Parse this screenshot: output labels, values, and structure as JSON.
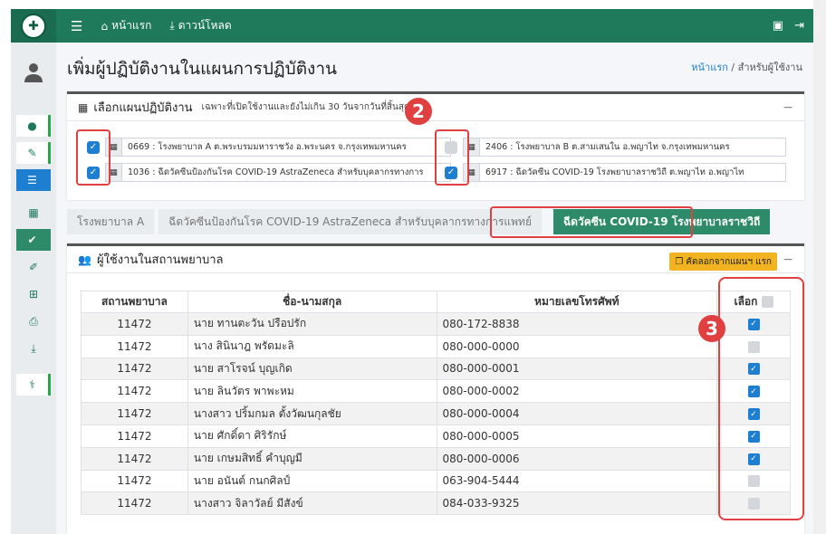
{
  "nav": {
    "home": "หน้าแรก",
    "download": "ดาวน์โหลด"
  },
  "page": {
    "title": "เพิ่มผู้ปฏิบัติงานในแผนการปฏิบัติงาน",
    "breadcrumb_home": "หน้าแรก",
    "breadcrumb_sep": "/",
    "breadcrumb_current": "สำหรับผู้ใช้งาน"
  },
  "plans_card": {
    "title": "เลือกแผนปฏิบัติงาน",
    "subtitle": "เฉพาะที่เปิดใช้งานและยังไม่เกิน 30 วันจากวันที่สิ้นสุด",
    "collapse": "−",
    "plans": [
      {
        "text": "0669 : โรงพยาบาล A  ต.พระบรมมหาราชวัง อ.พระนคร จ.กรุงเทพมหานคร",
        "checked": true
      },
      {
        "text": "2406 : โรงพยาบาล B  ต.สามเสนใน อ.พญาไท จ.กรุงเทพมหานคร",
        "checked": false
      },
      {
        "text": "1036 : ฉีดวัคซีนป้องกันโรค COVID-19 AstraZeneca สำหรับบุคลากรทางการ",
        "checked": true
      },
      {
        "text": "6917 : ฉีดวัคซีน COVID-19 โรงพยาบาลราชวิถี  ต.พญาไท อ.พญาไท",
        "checked": true
      }
    ]
  },
  "badges": {
    "b2": "2",
    "b3": "3"
  },
  "tabs": [
    {
      "label": "โรงพยาบาล A"
    },
    {
      "label": "ฉีดวัคซีนป้องกันโรค COVID-19 AstraZeneca สำหรับบุคลากรทางการแพทย์"
    },
    {
      "label": "ฉีดวัคซีน COVID-19 โรงพยาบาลราชวิถี"
    }
  ],
  "users_card": {
    "title": "ผู้ใช้งานในสถานพยาบาล",
    "copy_button": "คัดลอกจากแผนฯ แรก",
    "collapse": "−",
    "columns": {
      "hospital": "สถานพยาบาล",
      "name": "ชื่อ-นามสกุล",
      "phone": "หมายเลขโทรศัพท์",
      "select": "เลือก"
    },
    "rows": [
      {
        "hospital": "11472",
        "name": "นาย ทานตะวัน ปรือปรัก",
        "phone": "080-172-8838",
        "checked": true
      },
      {
        "hospital": "11472",
        "name": "นาง สินินาฎ พรัดมะลิ",
        "phone": "080-000-0000",
        "checked": false
      },
      {
        "hospital": "11472",
        "name": "นาย สาโรจน์ บุญเกิด",
        "phone": "080-000-0001",
        "checked": true
      },
      {
        "hospital": "11472",
        "name": "นาย ลินวัตร พาพะหม",
        "phone": "080-000-0002",
        "checked": true
      },
      {
        "hospital": "11472",
        "name": "นางสาว ปริ้มกมล ตั้งวัฒนกุลชัย",
        "phone": "080-000-0004",
        "checked": true
      },
      {
        "hospital": "11472",
        "name": "นาย ศักดิ์ดา ศิริรักษ์",
        "phone": "080-000-0005",
        "checked": true
      },
      {
        "hospital": "11472",
        "name": "นาย เกษมสิทธิ์ คำบุญมี",
        "phone": "080-000-0006",
        "checked": true
      },
      {
        "hospital": "11472",
        "name": "นาย อนันต์ กนกศิลป์",
        "phone": "063-904-5444",
        "checked": false
      },
      {
        "hospital": "11472",
        "name": "นางสาว จิลาวัลย์ มีสังข์",
        "phone": "084-033-9325",
        "checked": false
      }
    ]
  },
  "icons": {
    "menu": "menu-icon",
    "home": "home-icon",
    "download": "download-icon",
    "calendar": "calendar-icon",
    "users": "users-icon",
    "copy": "copy-icon",
    "logout": "logout-icon",
    "id_card": "id-card-icon"
  },
  "colors": {
    "topbar": "#1f7a5c",
    "accent_blue": "#1e7ed0",
    "active_tab": "#2e8b6a",
    "warning": "#f2b320",
    "annotation": "#e04040"
  }
}
